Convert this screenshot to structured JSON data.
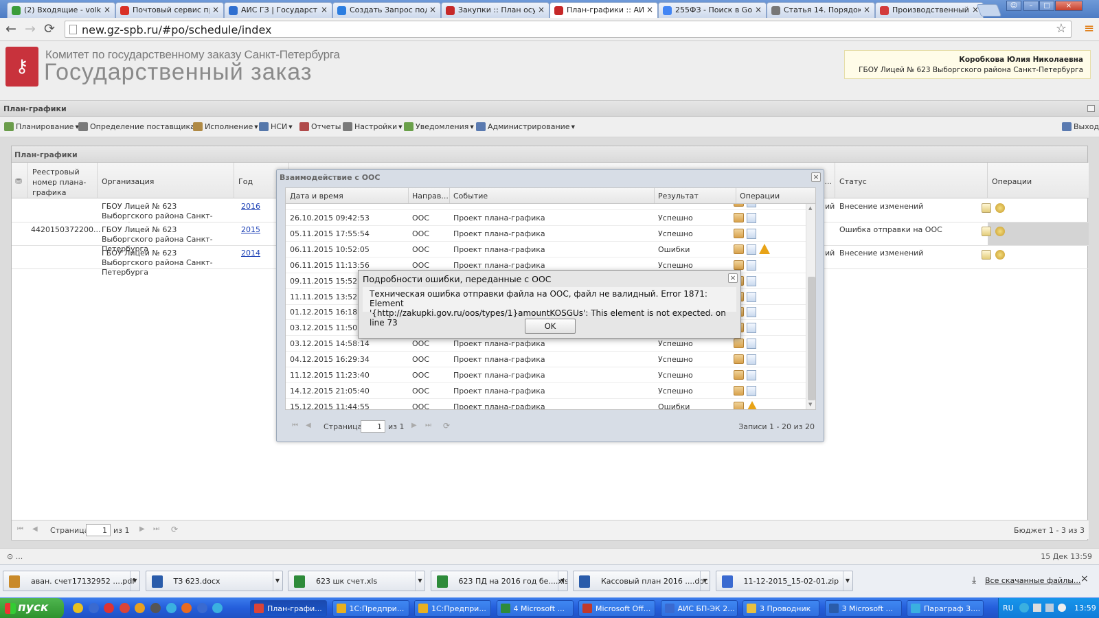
{
  "browser": {
    "tabs": [
      {
        "label": "(2) Входящие - volk",
        "icon_color": "#3a9c3a",
        "active": false
      },
      {
        "label": "Почтовый сервис пр",
        "icon_color": "#d93025",
        "active": false
      },
      {
        "label": "АИС ГЗ | Государств",
        "icon_color": "#2f6fd0",
        "active": false
      },
      {
        "label": "Создать Запрос под",
        "icon_color": "#2b7de0",
        "active": false
      },
      {
        "label": "Закупки :: План осу",
        "icon_color": "#c62828",
        "active": false
      },
      {
        "label": "План-графики :: АИС",
        "icon_color": "#c62828",
        "active": true
      },
      {
        "label": "255ФЗ - Поиск в Goo",
        "icon_color": "#4285f4",
        "active": false
      },
      {
        "label": "Статья 14. Порядок",
        "icon_color": "#777777",
        "active": false
      },
      {
        "label": "Производственный",
        "icon_color": "#d33a3a",
        "active": false
      }
    ],
    "url": "new.gz-spb.ru/#po/schedule/index"
  },
  "header": {
    "org_small": "Комитет по государственному заказу Санкт-Петербурга",
    "org_big": "Государственный заказ",
    "user_name": "Коробкова Юлия Николаевна",
    "user_org": "ГБОУ Лицей № 623 Выборгского района Санкт-Петербурга"
  },
  "panel_title": "План-графики",
  "menu": [
    {
      "label": "Планирование",
      "icon_color": "#6a9c4a"
    },
    {
      "label": "Определение поставщика",
      "icon_color": "#7a7a7a"
    },
    {
      "label": "Исполнение",
      "icon_color": "#b08a45"
    },
    {
      "label": "НСИ",
      "icon_color": "#5577aa"
    },
    {
      "label": "Отчеты",
      "icon_color": "#b04a4a"
    },
    {
      "label": "Настройки",
      "icon_color": "#7a7a7a"
    },
    {
      "label": "Уведомления",
      "icon_color": "#6aa04a"
    },
    {
      "label": "Администрирование",
      "icon_color": "#5a7ab0"
    }
  ],
  "menu_exit": "Выход",
  "grid": {
    "title": "План-графики",
    "columns": [
      "Реестровый номер плана-графика",
      "Организация",
      "Год",
      "Статус",
      "Операции"
    ],
    "rows": [
      {
        "reg": "",
        "org": "ГБОУ Лицей № 623 Выборгского района Санкт-Петербурга",
        "year": "2016",
        "mid": "ий",
        "status": "Внесение изменений",
        "selected": false
      },
      {
        "reg": "4420150372200...",
        "org": "ГБОУ Лицей № 623 Выборгского района Санкт-Петербурга",
        "year": "2015",
        "mid": "",
        "status": "Ошибка отправки на ООС",
        "selected": true
      },
      {
        "reg": "",
        "org": "ГБОУ Лицей № 623 Выборгского района Санкт-Петербурга",
        "year": "2014",
        "mid": "ий",
        "status": "Внесение изменений",
        "selected": false
      }
    ],
    "header_mid": "к...",
    "pager": {
      "page_label": "Страница",
      "page": "1",
      "of": "из 1",
      "summary": "Бюджет 1 - 3 из 3"
    }
  },
  "oos_dialog": {
    "title": "Взаимодействие с ООС",
    "columns": [
      "Дата и время",
      "Направ...",
      "Событие",
      "Результат",
      "Операции"
    ],
    "rows": [
      {
        "dt": "26.10.2015 09:42:53",
        "dir": "ООС",
        "event": "Проект плана-графика",
        "result": "Успешно",
        "warn": false,
        "doc": true
      },
      {
        "dt": "05.11.2015 17:55:54",
        "dir": "ООС",
        "event": "Проект плана-графика",
        "result": "Успешно",
        "warn": false,
        "doc": true
      },
      {
        "dt": "06.11.2015 10:52:05",
        "dir": "ООС",
        "event": "Проект плана-графика",
        "result": "Ошибки",
        "warn": true,
        "doc": true
      },
      {
        "dt": "06.11.2015 11:13:56",
        "dir": "ООС",
        "event": "Проект плана-графика",
        "result": "Успешно",
        "warn": false,
        "doc": true
      },
      {
        "dt": "09.11.2015 15:52:44",
        "dir": "",
        "event": "",
        "result": "",
        "warn": false,
        "doc": true
      },
      {
        "dt": "11.11.2015 13:52:57",
        "dir": "",
        "event": "",
        "result": "",
        "warn": false,
        "doc": true
      },
      {
        "dt": "01.12.2015 16:18:19",
        "dir": "",
        "event": "",
        "result": "",
        "warn": false,
        "doc": true
      },
      {
        "dt": "03.12.2015 11:50:49",
        "dir": "",
        "event": "",
        "result": "",
        "warn": false,
        "doc": true
      },
      {
        "dt": "03.12.2015 14:58:14",
        "dir": "ООС",
        "event": "Проект плана-графика",
        "result": "Успешно",
        "warn": false,
        "doc": true
      },
      {
        "dt": "04.12.2015 16:29:34",
        "dir": "ООС",
        "event": "Проект плана-графика",
        "result": "Успешно",
        "warn": false,
        "doc": true
      },
      {
        "dt": "11.12.2015 11:23:40",
        "dir": "ООС",
        "event": "Проект плана-графика",
        "result": "Успешно",
        "warn": false,
        "doc": true
      },
      {
        "dt": "14.12.2015 21:05:40",
        "dir": "ООС",
        "event": "Проект плана-графика",
        "result": "Успешно",
        "warn": false,
        "doc": true
      },
      {
        "dt": "15.12.2015 11:44:55",
        "dir": "ООС",
        "event": "Проект плана-графика",
        "result": "Ошибки",
        "warn": true,
        "doc": false
      }
    ],
    "pager": {
      "page_label": "Страница",
      "page": "1",
      "of": "из 1",
      "summary": "Записи 1 - 20 из 20"
    }
  },
  "error_dialog": {
    "title": "Подробности ошибки, переданные с ООС",
    "line1": "Техническая ошибка отправки файла на ООС, файл не валидный. Error 1871: Element",
    "line2": "'{http://zakupki.gov.ru/oos/types/1}amountKOSGUs': This element is not expected. on line 73",
    "ok": "OK"
  },
  "status": {
    "left": "⊙ ...",
    "right": "15 Дек 13:59"
  },
  "downloads": {
    "items": [
      {
        "label": "аван. счет17132952 ....pdf",
        "color": "#c98a2a"
      },
      {
        "label": "ТЗ 623.docx",
        "color": "#2a5caa"
      },
      {
        "label": "623 шк счет.xls",
        "color": "#2e8b3a"
      },
      {
        "label": "623 ПД на 2016 год бе....xls",
        "color": "#2e8b3a"
      },
      {
        "label": "Кассовый план 2016 ....doc",
        "color": "#2a5caa"
      },
      {
        "label": "11-12-2015_15-02-01.zip",
        "color": "#3a6ad0"
      }
    ],
    "all": "Все скачанные файлы...",
    "close": "×"
  },
  "taskbar": {
    "start": "пуск",
    "items": [
      {
        "label": "План-графи...",
        "color": "#db4437",
        "active": true
      },
      {
        "label": "1С:Предпри...",
        "color": "#e8b020",
        "active": false
      },
      {
        "label": "1С:Предпри...",
        "color": "#e8b020",
        "active": false
      },
      {
        "label": "4 Microsoft ...",
        "color": "#2e8b3a",
        "active": false
      },
      {
        "label": "Microsoft Off...",
        "color": "#c0392b",
        "active": false
      },
      {
        "label": "АИС БП-ЭК 2...",
        "color": "#3a6ad0",
        "active": false
      },
      {
        "label": "3 Проводник",
        "color": "#e8c040",
        "active": false
      },
      {
        "label": "3 Microsoft ...",
        "color": "#2a5caa",
        "active": false
      },
      {
        "label": "Параграф 3....",
        "color": "#3ab0e0",
        "active": false
      }
    ],
    "lang": "RU",
    "time": "13:59"
  }
}
